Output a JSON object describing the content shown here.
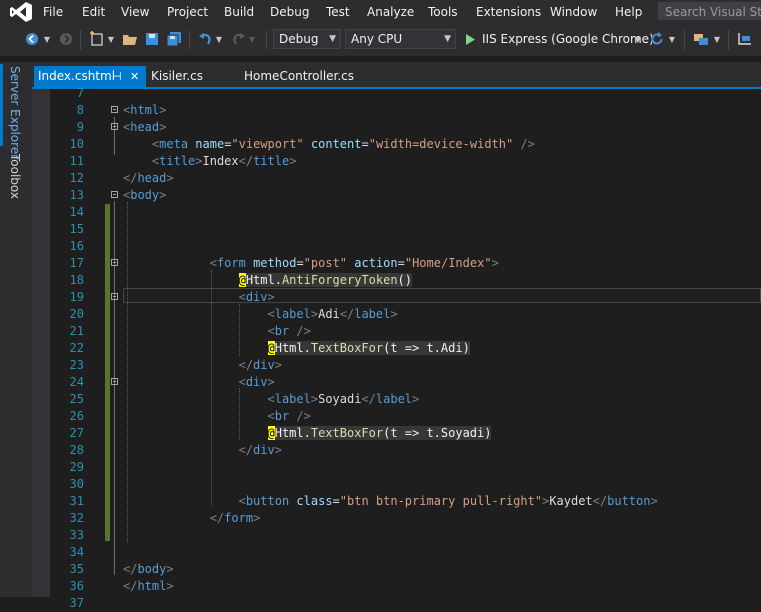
{
  "menu": {
    "items": [
      "File",
      "Edit",
      "View",
      "Project",
      "Build",
      "Debug",
      "Test",
      "Analyze",
      "Tools",
      "Extensions",
      "Window",
      "Help"
    ],
    "search_placeholder": "Search Visual Studio"
  },
  "toolbar": {
    "config_value": "Debug",
    "platform_value": "Any CPU",
    "run_label": "IIS Express (Google Chrome)"
  },
  "side_tabs": {
    "server_explorer": "Server Explorer",
    "toolbox": "Toolbox"
  },
  "tabs": [
    {
      "label": "Index.cshtml",
      "active": true
    },
    {
      "label": "Kisiler.cs"
    },
    {
      "label": "HomeController.cs"
    }
  ],
  "editor": {
    "lines": [
      {
        "n": "7",
        "segs": []
      },
      {
        "n": "8",
        "segs": [
          [
            "d",
            "<"
          ],
          [
            "tag",
            "html"
          ],
          [
            "d",
            ">"
          ]
        ]
      },
      {
        "n": "9",
        "segs": [
          [
            "d",
            "<"
          ],
          [
            "tag",
            "head"
          ],
          [
            "d",
            ">"
          ]
        ]
      },
      {
        "n": "10",
        "segs": [
          [
            "txt",
            "    "
          ],
          [
            "d",
            "<"
          ],
          [
            "tag",
            "meta"
          ],
          [
            "txt",
            " "
          ],
          [
            "attr",
            "name"
          ],
          [
            "txt",
            "="
          ],
          [
            "str",
            "\"viewport\""
          ],
          [
            "txt",
            " "
          ],
          [
            "attr",
            "content"
          ],
          [
            "txt",
            "="
          ],
          [
            "str",
            "\"width=device-width\""
          ],
          [
            "txt",
            " "
          ],
          [
            "d",
            "/>"
          ]
        ]
      },
      {
        "n": "11",
        "segs": [
          [
            "txt",
            "    "
          ],
          [
            "d",
            "<"
          ],
          [
            "tag",
            "title"
          ],
          [
            "d",
            ">"
          ],
          [
            "txt",
            "Index"
          ],
          [
            "d",
            "</"
          ],
          [
            "tag",
            "title"
          ],
          [
            "d",
            ">"
          ]
        ]
      },
      {
        "n": "12",
        "segs": [
          [
            "d",
            "</"
          ],
          [
            "tag",
            "head"
          ],
          [
            "d",
            ">"
          ]
        ]
      },
      {
        "n": "13",
        "segs": [
          [
            "d",
            "<"
          ],
          [
            "tag",
            "body"
          ],
          [
            "d",
            ">"
          ]
        ]
      },
      {
        "n": "14",
        "segs": []
      },
      {
        "n": "15",
        "segs": []
      },
      {
        "n": "16",
        "segs": []
      },
      {
        "n": "17",
        "segs": [
          [
            "txt",
            "            "
          ],
          [
            "d",
            "<"
          ],
          [
            "tag",
            "form"
          ],
          [
            "txt",
            " "
          ],
          [
            "attr",
            "method"
          ],
          [
            "txt",
            "="
          ],
          [
            "str",
            "\"post\""
          ],
          [
            "txt",
            " "
          ],
          [
            "attr",
            "action"
          ],
          [
            "txt",
            "="
          ],
          [
            "str",
            "\"Home/Index\""
          ],
          [
            "d",
            ">"
          ]
        ]
      },
      {
        "n": "18",
        "segs": [
          [
            "txt",
            "                "
          ],
          [
            "at",
            "@"
          ],
          [
            "razor",
            "Html."
          ],
          [
            "fn",
            "AntiForgeryToken"
          ],
          [
            "razor",
            "()"
          ]
        ]
      },
      {
        "n": "19",
        "segs": [
          [
            "txt",
            "                "
          ],
          [
            "d",
            "<"
          ],
          [
            "tag",
            "div"
          ],
          [
            "d",
            ">"
          ]
        ]
      },
      {
        "n": "20",
        "segs": [
          [
            "txt",
            "                    "
          ],
          [
            "d",
            "<"
          ],
          [
            "tag",
            "label"
          ],
          [
            "d",
            ">"
          ],
          [
            "txt",
            "Adi"
          ],
          [
            "d",
            "</"
          ],
          [
            "tag",
            "label"
          ],
          [
            "d",
            ">"
          ]
        ]
      },
      {
        "n": "21",
        "segs": [
          [
            "txt",
            "                    "
          ],
          [
            "d",
            "<"
          ],
          [
            "tag",
            "br"
          ],
          [
            "txt",
            " "
          ],
          [
            "d",
            "/>"
          ]
        ]
      },
      {
        "n": "22",
        "segs": [
          [
            "txt",
            "                    "
          ],
          [
            "at",
            "@"
          ],
          [
            "razor",
            "Html."
          ],
          [
            "fn",
            "TextBoxFor"
          ],
          [
            "razor",
            "(t => t.Adi)"
          ]
        ]
      },
      {
        "n": "23",
        "segs": [
          [
            "txt",
            "                "
          ],
          [
            "d",
            "</"
          ],
          [
            "tag",
            "div"
          ],
          [
            "d",
            ">"
          ]
        ]
      },
      {
        "n": "24",
        "segs": [
          [
            "txt",
            "                "
          ],
          [
            "d",
            "<"
          ],
          [
            "tag",
            "div"
          ],
          [
            "d",
            ">"
          ]
        ]
      },
      {
        "n": "25",
        "segs": [
          [
            "txt",
            "                    "
          ],
          [
            "d",
            "<"
          ],
          [
            "tag",
            "label"
          ],
          [
            "d",
            ">"
          ],
          [
            "txt",
            "Soyadi"
          ],
          [
            "d",
            "</"
          ],
          [
            "tag",
            "label"
          ],
          [
            "d",
            ">"
          ]
        ]
      },
      {
        "n": "26",
        "segs": [
          [
            "txt",
            "                    "
          ],
          [
            "d",
            "<"
          ],
          [
            "tag",
            "br"
          ],
          [
            "txt",
            " "
          ],
          [
            "d",
            "/>"
          ]
        ]
      },
      {
        "n": "27",
        "segs": [
          [
            "txt",
            "                    "
          ],
          [
            "at",
            "@"
          ],
          [
            "razor",
            "Html."
          ],
          [
            "fn",
            "TextBoxFor"
          ],
          [
            "razor",
            "(t => t.Soyadi)"
          ]
        ]
      },
      {
        "n": "28",
        "segs": [
          [
            "txt",
            "                "
          ],
          [
            "d",
            "</"
          ],
          [
            "tag",
            "div"
          ],
          [
            "d",
            ">"
          ]
        ]
      },
      {
        "n": "29",
        "segs": []
      },
      {
        "n": "30",
        "segs": []
      },
      {
        "n": "31",
        "segs": [
          [
            "txt",
            "                "
          ],
          [
            "d",
            "<"
          ],
          [
            "tag",
            "button"
          ],
          [
            "txt",
            " "
          ],
          [
            "attr",
            "class"
          ],
          [
            "txt",
            "="
          ],
          [
            "str",
            "\"btn btn-primary pull-right\""
          ],
          [
            "d",
            ">"
          ],
          [
            "txt",
            "Kaydet"
          ],
          [
            "d",
            "</"
          ],
          [
            "tag",
            "button"
          ],
          [
            "d",
            ">"
          ]
        ]
      },
      {
        "n": "32",
        "segs": [
          [
            "txt",
            "            "
          ],
          [
            "d",
            "</"
          ],
          [
            "tag",
            "form"
          ],
          [
            "d",
            ">"
          ]
        ]
      },
      {
        "n": "33",
        "segs": []
      },
      {
        "n": "34",
        "segs": []
      },
      {
        "n": "35",
        "segs": [
          [
            "d",
            "</"
          ],
          [
            "tag",
            "body"
          ],
          [
            "d",
            ">"
          ]
        ]
      },
      {
        "n": "36",
        "segs": [
          [
            "d",
            "</"
          ],
          [
            "tag",
            "html"
          ],
          [
            "d",
            ">"
          ]
        ]
      },
      {
        "n": "37",
        "segs": []
      }
    ]
  }
}
